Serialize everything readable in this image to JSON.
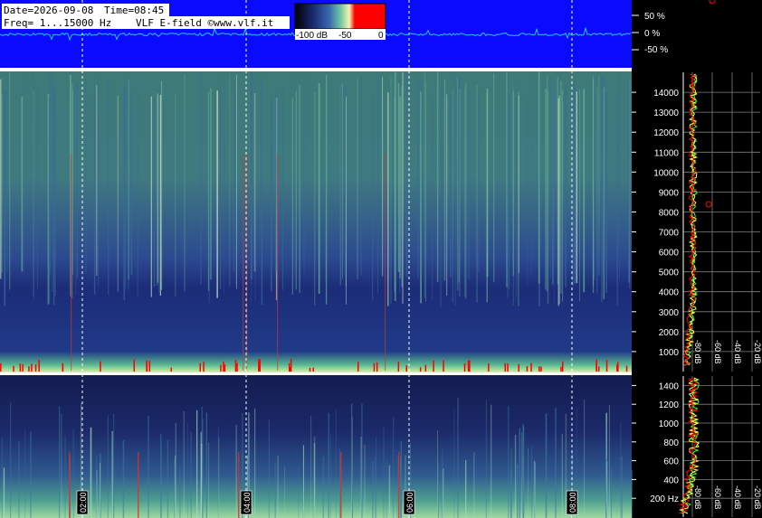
{
  "header": {
    "date_label": "Date=2026-09-08",
    "time_label": "Time=08:45",
    "freq_label": "Freq= 1...15000 Hz",
    "source_label": "VLF E-field ©www.vlf.it"
  },
  "colorbar": {
    "tick_labels": [
      "-100 dB",
      "-50",
      "0"
    ],
    "colors": [
      "#000000",
      "#1a2a70",
      "#3a6ab0",
      "#6fc3a0",
      "#f4f4b0",
      "#ff0000"
    ]
  },
  "waveform": {
    "tick_labels": [
      "50 %",
      "0 %",
      "-50 %"
    ],
    "background": "#0a0aff",
    "trace_color": "#22c8ff"
  },
  "colors": {
    "accent_red": "#ff0000",
    "spectrum_yellow": "#ffff40",
    "spectrum_green": "#40ff40",
    "grid_gray": "#808080"
  },
  "chart_data": [
    {
      "type": "heatmap",
      "panel": "upper spectrogram",
      "ylim": [
        0,
        15000
      ],
      "y_tick_labels": [
        "1000",
        "2000",
        "3000",
        "4000",
        "5000",
        "6000",
        "7000",
        "8000",
        "9000",
        "10000",
        "11000",
        "12000",
        "13000",
        "14000"
      ],
      "y_ticks": [
        1000,
        2000,
        3000,
        4000,
        5000,
        6000,
        7000,
        8000,
        9000,
        10000,
        11000,
        12000,
        13000,
        14000
      ],
      "x_time_markers": [
        "02:00",
        "04:00",
        "06:00",
        "08:00"
      ]
    },
    {
      "type": "heatmap",
      "panel": "lower spectrogram",
      "ylim": [
        0,
        1500
      ],
      "y_tick_labels": [
        "200 Hz",
        "400",
        "600",
        "800",
        "1000",
        "1200",
        "1400"
      ],
      "y_ticks": [
        200,
        400,
        600,
        800,
        1000,
        1200,
        1400
      ],
      "x_time_markers": [
        "02:00",
        "04:00",
        "06:00",
        "08:00"
      ]
    },
    {
      "type": "line",
      "panel": "upper spectrum",
      "x_tick_labels": [
        "-80 dB",
        "-60 dB",
        "-40 dB",
        "-20 dB"
      ],
      "x_ticks": [
        -80,
        -60,
        -40,
        -20
      ]
    },
    {
      "type": "line",
      "panel": "lower spectrum",
      "x_tick_labels": [
        "-80 dB",
        "-60 dB",
        "-40 dB",
        "-20 dB"
      ],
      "x_ticks": [
        -80,
        -60,
        -40,
        -20
      ]
    }
  ]
}
